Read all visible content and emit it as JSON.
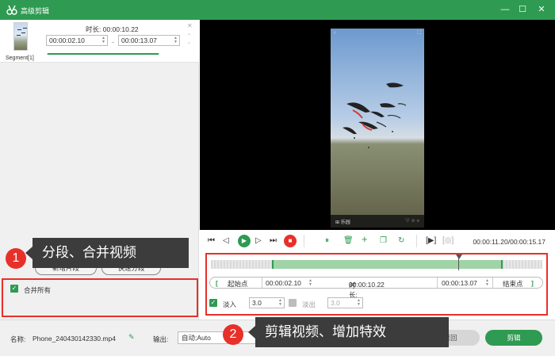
{
  "window": {
    "title": "高级剪辑",
    "minimize": "—",
    "maximize": "☐",
    "close": "✕"
  },
  "segment": {
    "label": "Segment[1]",
    "duration_label": "时长:",
    "duration_value": "00:00:10.22",
    "start_time": "00:00:02.10",
    "end_time": "00:00:13.07",
    "separator": "-",
    "progress": 1.0
  },
  "left_panel": {
    "new_segment_button": "新增片段",
    "quick_split_button": "快速分段",
    "merge_all_label": "合并所有",
    "merge_all_checked": true
  },
  "annotations": [
    {
      "number": "1",
      "text": "分段、合并视频"
    },
    {
      "number": "2",
      "text": "剪辑视频、增加特效"
    }
  ],
  "preview": {
    "phone_top_left": "‹",
    "phone_top_right": "⛶",
    "phone_bottom_left": "⊞ 乐园",
    "phone_bottom_right": "♡ ☆ ○"
  },
  "controls": {
    "timecode": "00:00:11.20/00:00:15.17",
    "icons": [
      "skip-start",
      "step-back",
      "play",
      "step-forward",
      "skip-end",
      "stop",
      "split",
      "delete",
      "add",
      "copy",
      "reset",
      "mark-bracket",
      "snapshot"
    ]
  },
  "editor": {
    "start_point_label": "起始点",
    "start_time": "00:00:02.10",
    "duration_label": "时长:",
    "duration_value": "00:00:10.22",
    "end_time": "00:00:13.07",
    "end_point_label": "结束点",
    "bracket_left": "[",
    "bracket_right": "]",
    "fade_in_label": "淡入",
    "fade_in_value": "3.0",
    "fade_in_checked": true,
    "fade_out_label": "淡出",
    "fade_out_value": "3.0",
    "fade_out_checked": false
  },
  "bottom": {
    "name_label": "名称:",
    "file_name": "Phone_240430142330.mp4",
    "output_label": "输出:",
    "output_value": "自动;Auto",
    "back_button": "返回",
    "cut_button": "剪辑"
  },
  "colors": {
    "brand_green": "#2f9a52",
    "annotation_red": "#e8302a",
    "callout_bg": "#3c3c3c"
  }
}
